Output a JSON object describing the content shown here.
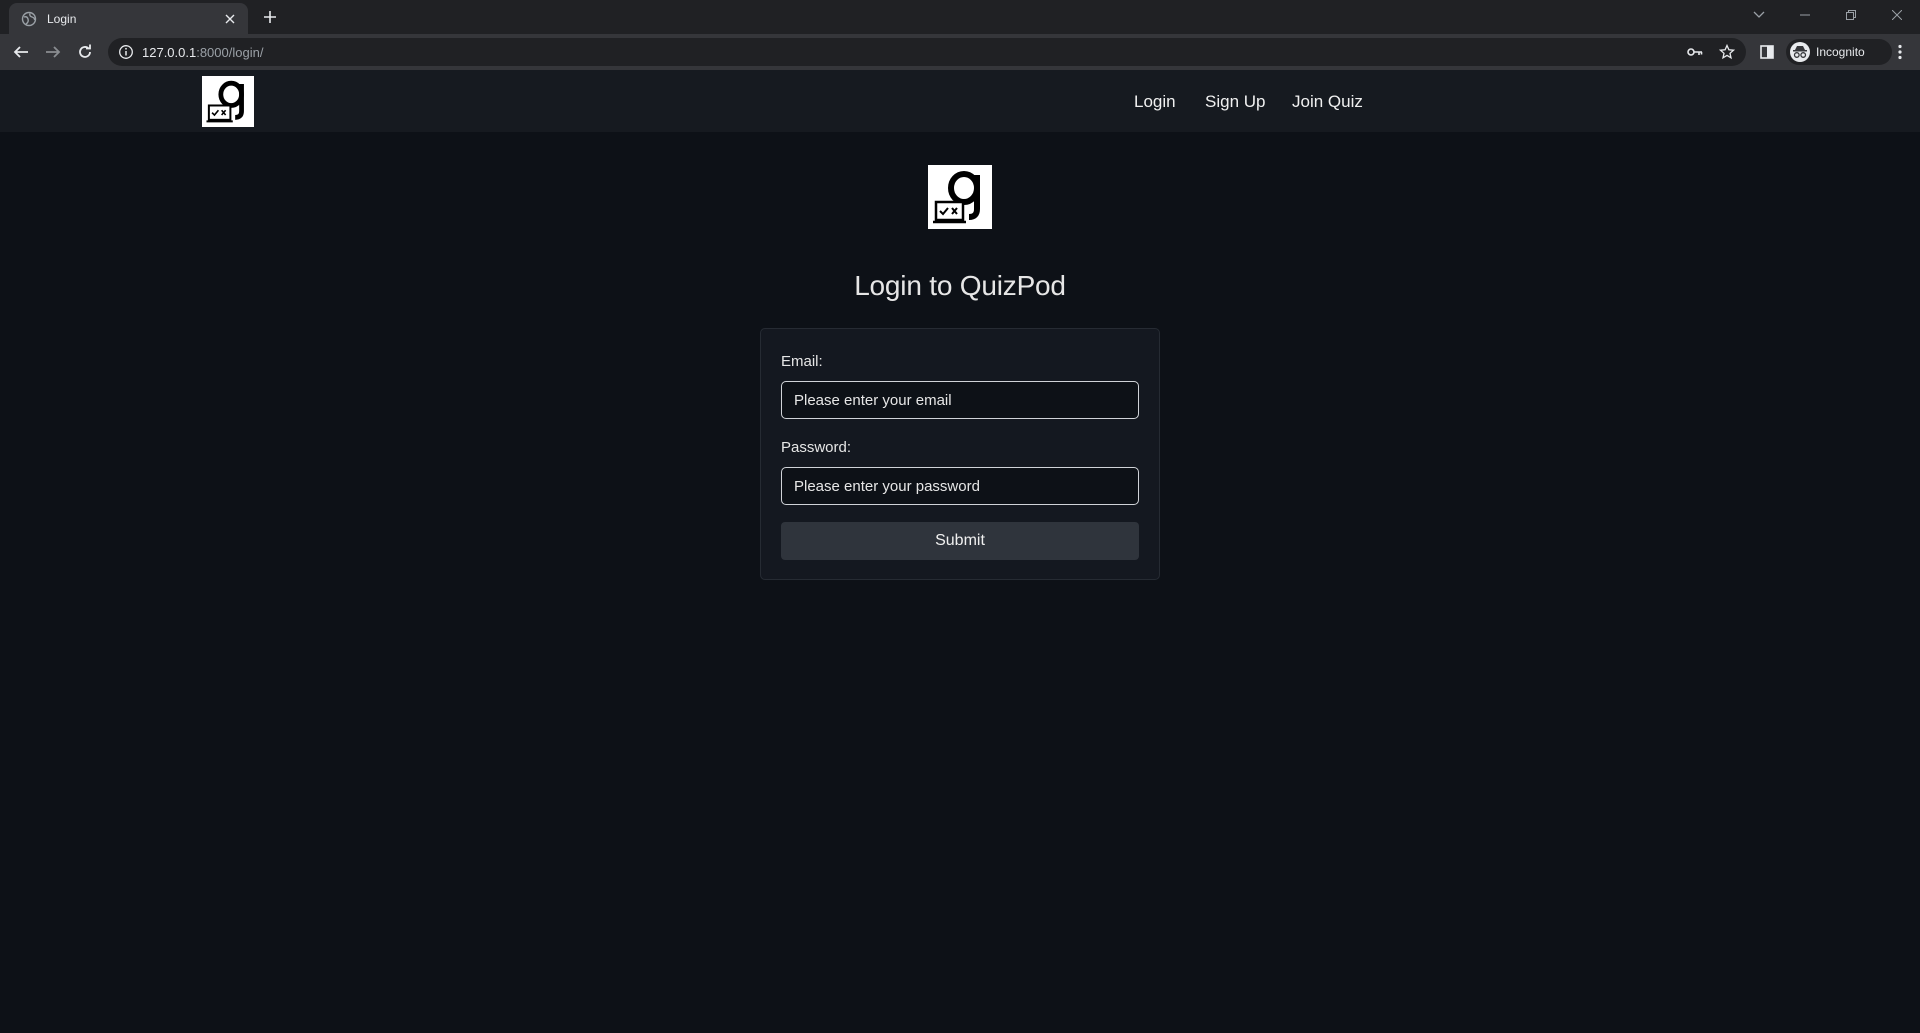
{
  "browser": {
    "tab_title": "Login",
    "url_host": "127.0.0.1",
    "url_path": ":8000/login/",
    "profile_label": "Incognito"
  },
  "nav": {
    "links": [
      "Login",
      "Sign Up",
      "Join Quiz"
    ]
  },
  "login": {
    "title": "Login to QuizPod",
    "email_label": "Email:",
    "email_placeholder": "Please enter your email",
    "password_label": "Password:",
    "password_placeholder": "Please enter your password",
    "submit_label": "Submit"
  },
  "colors": {
    "page_bg": "#0d1117",
    "navbar_bg": "#161a20",
    "card_bg": "#141820",
    "button_bg": "#2f343c"
  },
  "icons": {
    "logo": "quizpod-logo-icon"
  }
}
